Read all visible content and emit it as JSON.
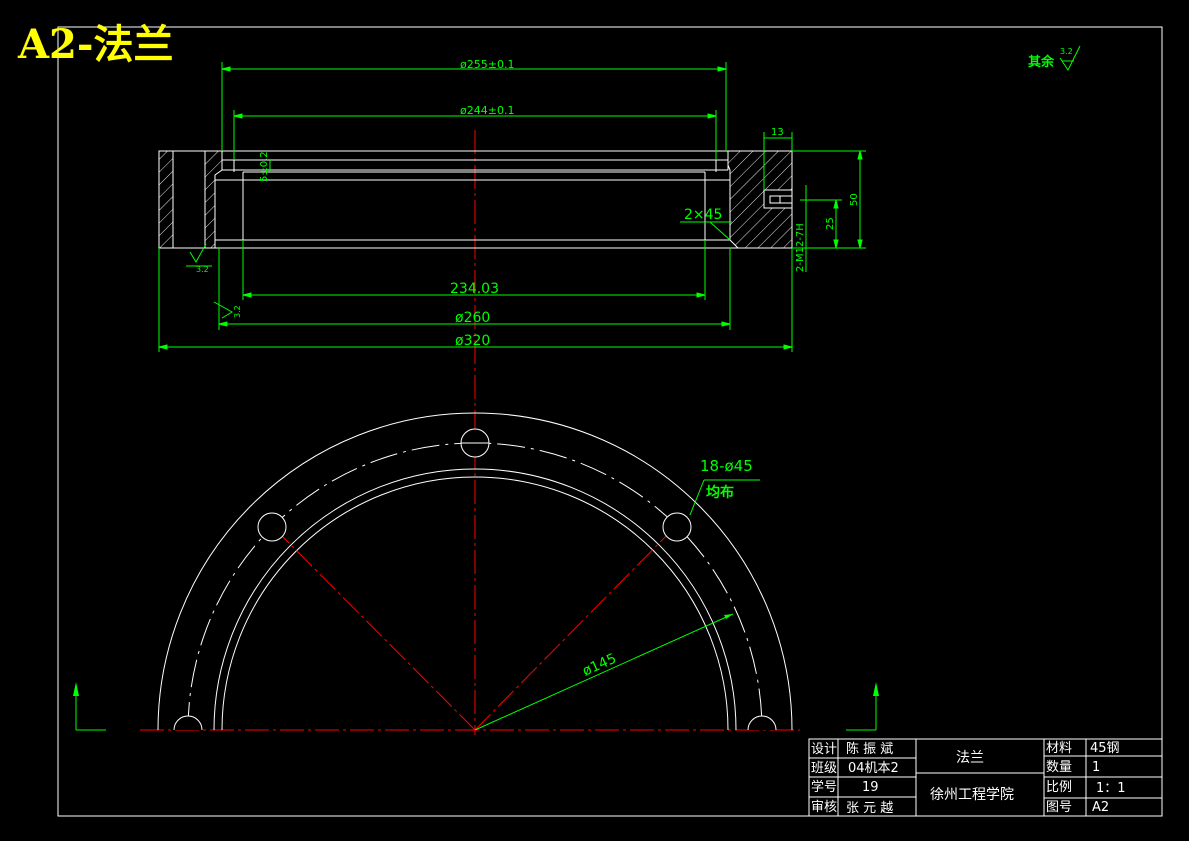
{
  "sheet": {
    "format_title": "A2-法兰",
    "surface_note": "其余",
    "surface_value": "3.2"
  },
  "section_view": {
    "dimensions": {
      "d255": "ø255±0.1",
      "d244": "ø244±0.1",
      "d260": "ø260",
      "d320": "ø320",
      "len234": "234.03",
      "chamfer": "2×45",
      "w13": "13",
      "h50": "50",
      "h25": "25",
      "thread": "2-M12-7H",
      "groove": "5±0.2"
    },
    "roughness": [
      "3.2",
      "3.2"
    ]
  },
  "plan_view": {
    "hole_callout": "18-ø45",
    "hole_note": "均布",
    "pcd_label": "ø145"
  },
  "title_block": {
    "design_label": "设计",
    "design_value": "陈 振 斌",
    "class_label": "班级",
    "class_value": "04机本2",
    "student_no_label": "学号",
    "student_no_value": "19",
    "review_label": "审核",
    "review_value": "张 元 越",
    "part_name": "法兰",
    "school": "徐州工程学院",
    "material_label": "材料",
    "material_value": "45钢",
    "qty_label": "数量",
    "qty_value": "1",
    "scale_label": "比例",
    "scale_value": "1：1",
    "drawing_no_label": "图号",
    "drawing_no_value": "A2"
  },
  "colors": {
    "outline": "#ffffff",
    "dimension": "#00ff00",
    "centerline": "#ff0000",
    "title": "#ffff00"
  }
}
